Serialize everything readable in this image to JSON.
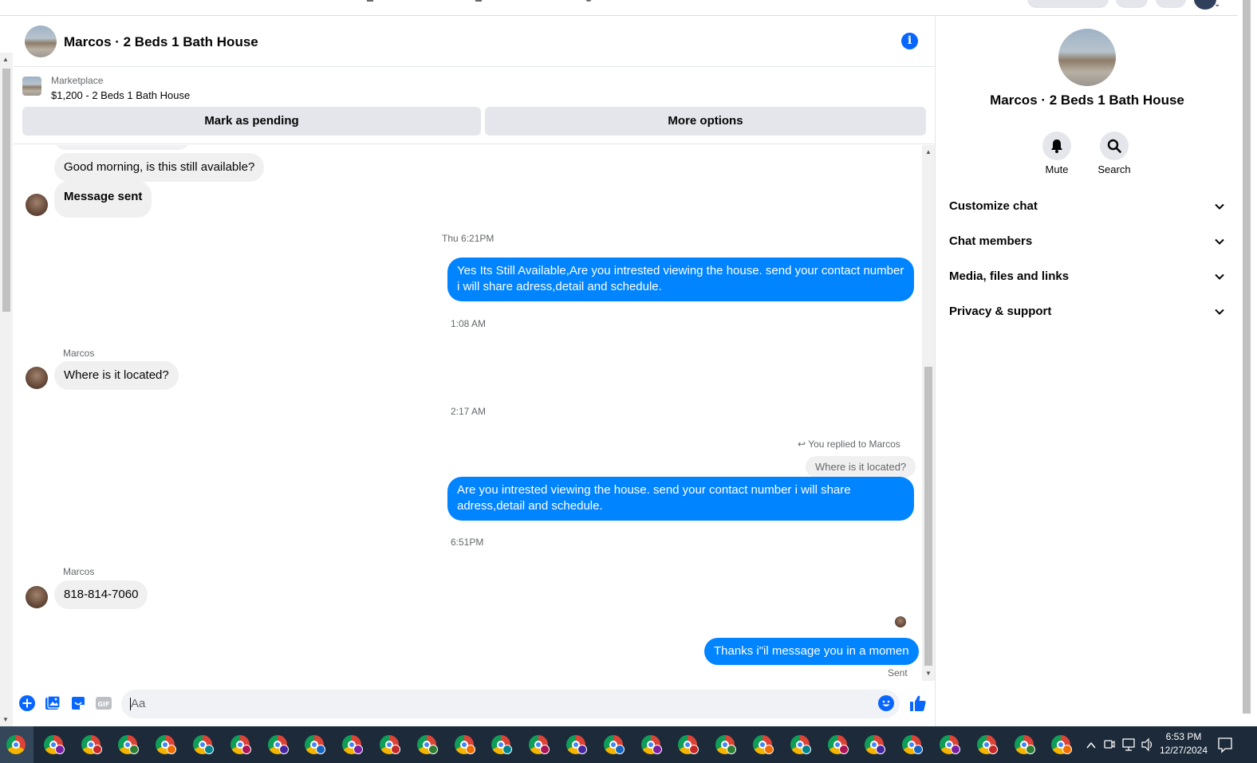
{
  "chat": {
    "title": "Marcos · 2 Beds 1 Bath House",
    "marketplace_label": "Marketplace",
    "listing": "$1,200 - 2 Beds 1 Bath House",
    "mark_pending_label": "Mark as pending",
    "more_options_label": "More options",
    "input_placeholder": "Aa",
    "messages": {
      "m1": "Good morning, is this still available?",
      "m2": "Message sent",
      "t1": "Thu 6:21PM",
      "m3": "Yes Its Still Available,Are you intrested viewing the house. send your contact number i will share adress,detail and schedule.",
      "t2": "1:08 AM",
      "s1": "Marcos",
      "m4": "Where is it located?",
      "t3": "2:17 AM",
      "reply_note": "You replied to Marcos",
      "quote": "Where is it located?",
      "m5": "Are you intrested viewing the house. send your contact number i will share adress,detail and schedule.",
      "t4": "6:51PM",
      "s2": "Marcos",
      "m6": "818-814-7060",
      "m7": "Thanks i\"il message you in a momen",
      "status": "Sent"
    }
  },
  "details": {
    "title": "Marcos · 2 Beds 1 Bath House",
    "mute_label": "Mute",
    "search_label": "Search",
    "sections": [
      "Customize chat",
      "Chat members",
      "Media, files and links",
      "Privacy & support"
    ]
  },
  "taskbar": {
    "time": "6:53 PM",
    "date": "12/27/2024"
  },
  "colors": {
    "accent": "#0866ff",
    "outgoing_bubble": "#0084ff",
    "incoming_bubble": "#f0f0f0",
    "taskbar": "#1c2a3a"
  }
}
